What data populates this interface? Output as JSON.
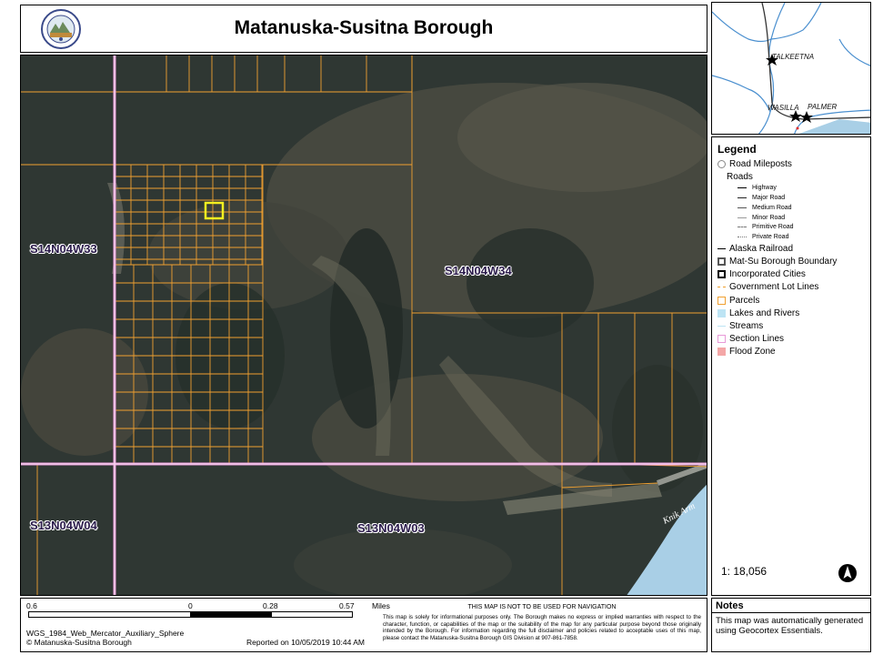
{
  "header": {
    "title": "Matanuska-Susitna Borough"
  },
  "map": {
    "section_labels": [
      "S14N04W33",
      "S14N04W34",
      "S13N04W04",
      "S13N04W03"
    ],
    "place_label": "Knik Arm"
  },
  "inset": {
    "places": [
      "TALKEETNA",
      "WASILLA",
      "PALMER"
    ]
  },
  "legend": {
    "title": "Legend",
    "road_mileposts": "Road Mileposts",
    "roads_heading": "Roads",
    "roads": [
      "Highway",
      "Major Road",
      "Medium Road",
      "Minor Road",
      "Primitive Road",
      "Private Road"
    ],
    "layers": [
      {
        "label": "Alaska Railroad",
        "color": "#000000"
      },
      {
        "label": "Mat-Su Borough Boundary",
        "color": "#555555"
      },
      {
        "label": "Incorporated Cities",
        "color": "#000000"
      },
      {
        "label": "Government Lot Lines",
        "color": "#f0a030"
      },
      {
        "label": "Parcels",
        "color": "#f0a030"
      },
      {
        "label": "Lakes and Rivers",
        "color": "#bde4f4"
      },
      {
        "label": "Streams",
        "color": "#bde4f4"
      },
      {
        "label": "Section Lines",
        "color": "#e89ad8"
      },
      {
        "label": "Flood Zone",
        "color": "#f4a7a7"
      }
    ],
    "scale": "1: 18,056"
  },
  "scalebar": {
    "ticks": [
      "0.6",
      "0",
      "0.28",
      "0.57"
    ],
    "unit": "Miles",
    "projection": "WGS_1984_Web_Mercator_Auxiliary_Sphere",
    "copyright": "© Matanuska-Susitna Borough",
    "reported": "Reported on 10/05/2019 10:44 AM"
  },
  "disclaimer": {
    "title": "THIS MAP IS NOT TO BE USED FOR NAVIGATION",
    "text": "This map is solely for informational purposes only. The Borough makes no express or implied warranties with respect to the character, function, or capabilities of the map or the suitability of the map for any particular purpose beyond those originally intended by the Borough. For information regarding the full disclaimer and policies related to acceptable uses of this map, please contact the Matanuska-Susitna Borough GIS Division at 907-861-7858."
  },
  "notes": {
    "title": "Notes",
    "text": "This map was automatically generated using Geocortex Essentials."
  },
  "colors": {
    "parcel_line": "#f0a030",
    "section_line": "#e89ad8",
    "highlight": "#f4f020",
    "water": "#a9cfe6",
    "imagery_dark": "#2c3430"
  }
}
